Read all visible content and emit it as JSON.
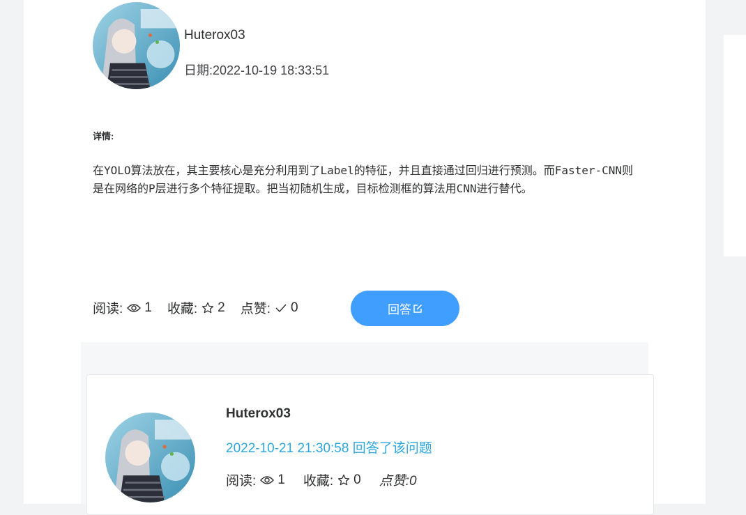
{
  "question": {
    "author": "Huterox03",
    "date": "日期:2022-10-19 18:33:51",
    "detail_label": "详情:",
    "detail_text": "在YOLO算法放在，其主要核心是充分利用到了Label的特征，并且直接通过回归进行预测。而Faster-CNN则是在网络的P层进行多个特征提取。把当初随机生成，目标检测框的算法用CNN进行替代。",
    "stats": {
      "reads_label": "阅读:",
      "reads": "1",
      "favorites_label": "收藏:",
      "favorites": "2",
      "likes_label": "点赞:",
      "likes": "0"
    },
    "answer_button_label": "回答"
  },
  "answers": [
    {
      "author": "Huterox03",
      "time": "2022-10-21 21:30:58 回答了该问题",
      "reads_label": "阅读:",
      "reads": "1",
      "favorites_label": "收藏:",
      "favorites": "0",
      "likes_text": "点赞:0"
    }
  ],
  "icons": {
    "reads": "eye-icon",
    "favorites": "star-outline-icon",
    "likes": "check-icon",
    "answer": "edit-icon"
  },
  "colors": {
    "accent": "#409eff",
    "answer_time": "#2ea7e0",
    "text": "#303133"
  }
}
